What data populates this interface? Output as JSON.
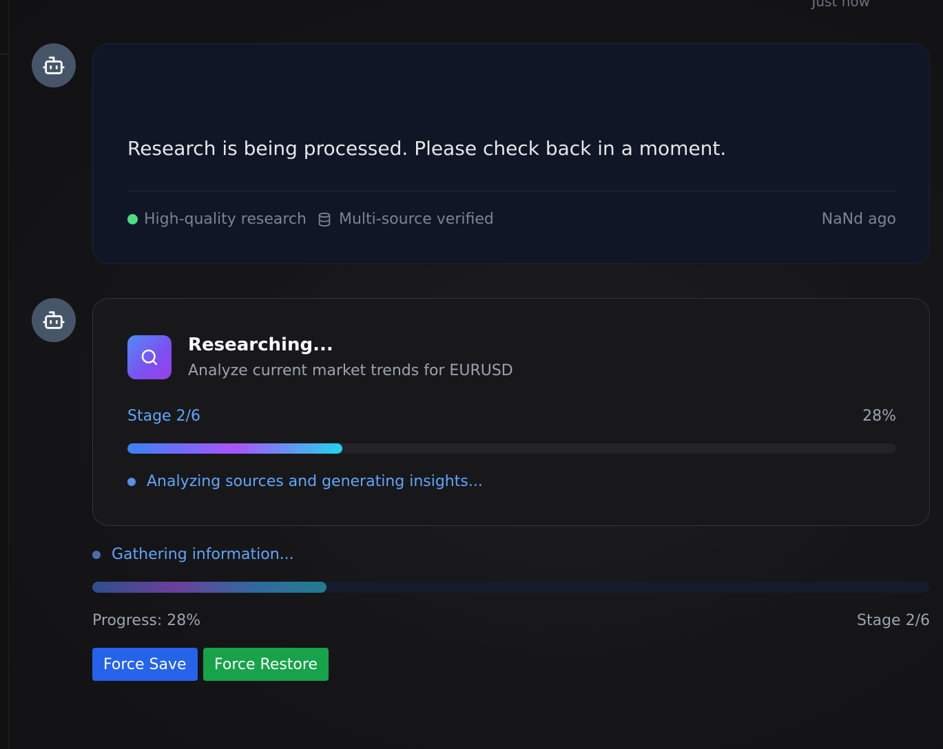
{
  "header": {
    "timestamp": "Just now"
  },
  "message1": {
    "text": "Research is being processed. Please check back in a moment.",
    "quality_label": "High-quality research",
    "verified_label": "Multi-source verified",
    "time_ago": "NaNd ago"
  },
  "message2": {
    "title": "Researching...",
    "subtitle": "Analyze current market trends for EURUSD",
    "stage_label": "Stage 2/6",
    "percent_label": "28%",
    "progress_fraction": 0.28,
    "status_text": "Analyzing sources and generating insights..."
  },
  "footer": {
    "status_text": "Gathering information...",
    "progress_label": "Progress: 28%",
    "progress_fraction": 0.28,
    "stage_label": "Stage 2/6",
    "force_save_label": "Force Save",
    "force_restore_label": "Force Restore"
  },
  "icons": {
    "avatar": "bot-icon",
    "search": "search-icon",
    "database": "database-icon",
    "status_dot": "dot-icon"
  },
  "colors": {
    "accent_blue": "#60a5fa",
    "success_green": "#4ade80",
    "save_button": "#2563eb",
    "restore_button": "#16a34a"
  }
}
